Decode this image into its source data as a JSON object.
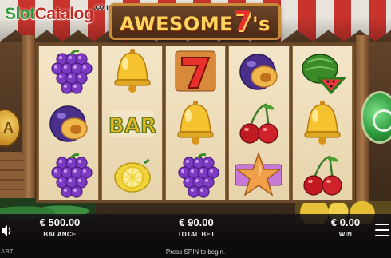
{
  "site_logo": {
    "part1": "Slot",
    "part2": "Catalog",
    "suffix": ".com"
  },
  "game_title": {
    "prefix": "AWESOME",
    "seven": "7",
    "suffix": "'s"
  },
  "reels": [
    [
      "grapes",
      "plum",
      "grapes"
    ],
    [
      "bell",
      "bar",
      "lemon"
    ],
    [
      "seven",
      "bell",
      "grapes"
    ],
    [
      "plum",
      "cherries",
      "star"
    ],
    [
      "watermelon",
      "bell",
      "cherries"
    ]
  ],
  "side_coin": {
    "label": "A"
  },
  "bottom_bar": {
    "balance": {
      "value": "€ 500.00",
      "label": "BALANCE"
    },
    "total_bet": {
      "value": "€ 90.00",
      "label": "TOTAL BET"
    },
    "win": {
      "value": "€ 0.00",
      "label": "WIN"
    }
  },
  "footer": {
    "message": "Press SPIN to begin.",
    "brand": "ART"
  },
  "icons": [
    "sound-icon",
    "menu-icon",
    "spin-icon"
  ],
  "colors": {
    "awning_red": "#c8332c",
    "awning_white": "#e8e4dc",
    "spin_green": "#2c9a3a",
    "gold": "#ffd45a"
  }
}
